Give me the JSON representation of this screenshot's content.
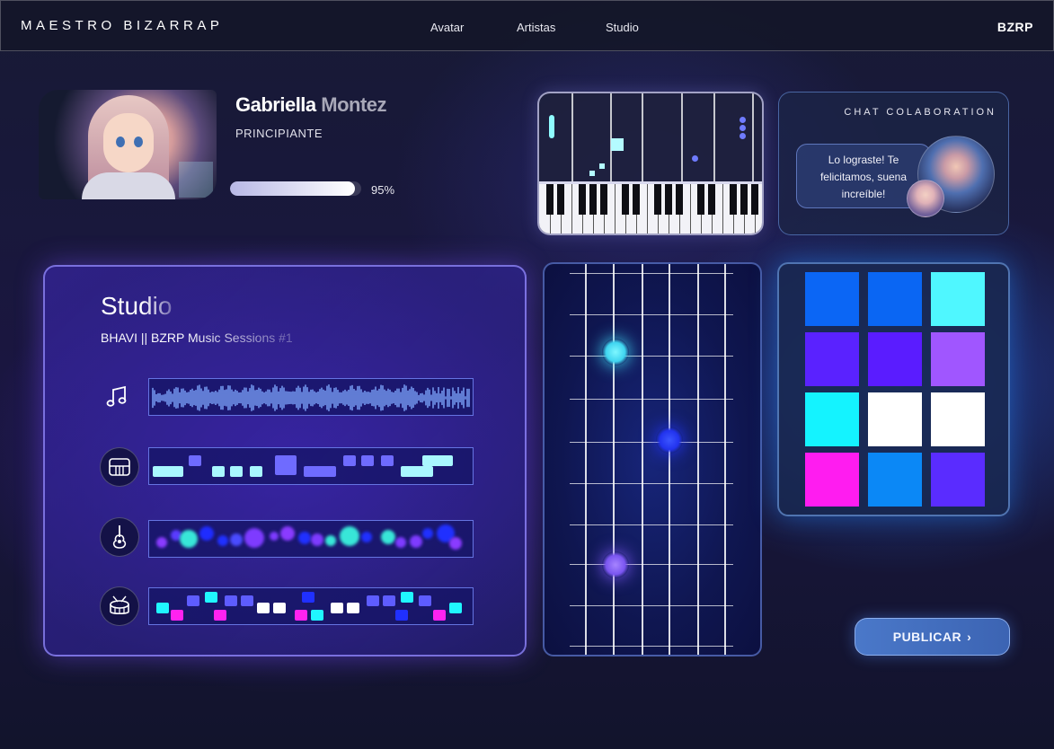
{
  "nav": {
    "brand": "MAESTRO BIZARRAP",
    "links": [
      "Avatar",
      "Artistas",
      "Studio"
    ],
    "right": "BZRP"
  },
  "profile": {
    "first_name": "Gabriella",
    "last_name": "Montez",
    "level": "PRINCIPIANTE",
    "progress_value": 0.95,
    "progress_label": "95%"
  },
  "chat": {
    "title": "CHAT COLABORATION",
    "message": "Lo lograste! Te felicitamos, suena increíble!"
  },
  "studio": {
    "title": "Studio",
    "subtitle": "BHAVI || BZRP Music Sessions #1",
    "tracks": [
      {
        "icon": "music-note-icon",
        "type": "waveform"
      },
      {
        "icon": "piano-icon",
        "type": "blocks"
      },
      {
        "icon": "guitar-icon",
        "type": "dots"
      },
      {
        "icon": "drum-icon",
        "type": "drum-blocks"
      }
    ]
  },
  "pads": {
    "colors": [
      "#0b66f5",
      "#0a66f3",
      "#4ff7ff",
      "#5a22ff",
      "#5a1cff",
      "#a056ff",
      "#14f3ff",
      "#ffffff",
      "#ffffff",
      "#ff1cf0",
      "#0b88f6",
      "#5a2cff"
    ]
  },
  "colors": {
    "accent_purple": "#6a4cff",
    "accent_cyan": "#4ff7ff",
    "accent_blue": "#3c64b3"
  },
  "publish_label": "PUBLICAR"
}
